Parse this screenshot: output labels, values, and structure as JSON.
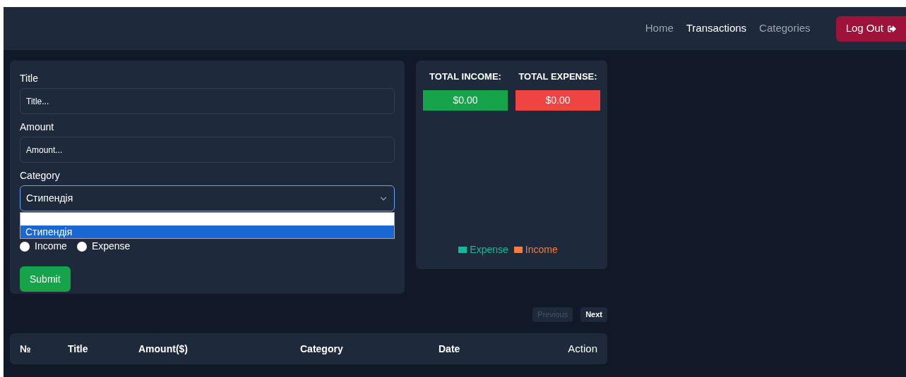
{
  "nav": {
    "links": [
      {
        "label": "Home",
        "selected": false
      },
      {
        "label": "Transactions",
        "selected": true
      },
      {
        "label": "Categories",
        "selected": false
      }
    ],
    "logout": "Log Out"
  },
  "form": {
    "fields": [
      {
        "label": "Title",
        "placeholder": "Title..."
      },
      {
        "label": "Amount",
        "placeholder": "Amount..."
      }
    ],
    "category": {
      "label": "Category",
      "value": "Стипендія",
      "expanded": true,
      "options": [
        {
          "label": "Стипендія",
          "selected": true
        }
      ]
    },
    "radios": [
      {
        "label": "Income",
        "checked": false
      },
      {
        "label": "Expense",
        "checked": false
      }
    ],
    "submit": "Submit"
  },
  "summary": {
    "totals": [
      {
        "label": "TOTAL INCOME:",
        "value": "$0.00",
        "color": "#16a34a"
      },
      {
        "label": "TOTAL EXPENSE:",
        "value": "$0.00",
        "color": "#ef4444"
      }
    ],
    "legend": [
      {
        "label": "Expense",
        "color": "#10b9a0"
      },
      {
        "label": "Income",
        "color": "#f47c3c"
      }
    ]
  },
  "pagination": [
    {
      "label": "Previous",
      "disabled": true
    },
    {
      "label": "Next",
      "disabled": false
    }
  ],
  "table": {
    "columns": [
      "№",
      "Title",
      "Amount($)",
      "Category",
      "Date",
      "Action"
    ]
  }
}
